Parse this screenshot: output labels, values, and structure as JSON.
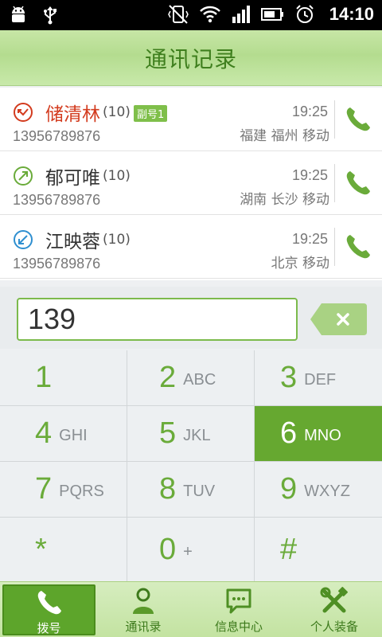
{
  "status_bar": {
    "time": "14:10"
  },
  "header": {
    "title": "通讯记录"
  },
  "call_log": [
    {
      "name": "储清林",
      "count": "(10)",
      "badge": "副号1",
      "number": "13956789876",
      "time": "19:25",
      "location": "福建 福州 移动",
      "type": "missed",
      "color": "#d33b1e"
    },
    {
      "name": "郁可唯",
      "count": "(10)",
      "badge": "",
      "number": "13956789876",
      "time": "19:25",
      "location": "湖南 长沙 移动",
      "type": "outgoing",
      "color": "#6aab3a"
    },
    {
      "name": "江映蓉",
      "count": "(10)",
      "badge": "",
      "number": "13956789876",
      "time": "19:25",
      "location": "北京 移动",
      "type": "incoming",
      "color": "#2f8fd0"
    }
  ],
  "dial_input": {
    "value": "139"
  },
  "keypad": [
    {
      "digit": "1",
      "letters": ""
    },
    {
      "digit": "2",
      "letters": "ABC"
    },
    {
      "digit": "3",
      "letters": "DEF"
    },
    {
      "digit": "4",
      "letters": "GHI"
    },
    {
      "digit": "5",
      "letters": "JKL"
    },
    {
      "digit": "6",
      "letters": "MNO",
      "active": true
    },
    {
      "digit": "7",
      "letters": "PQRS"
    },
    {
      "digit": "8",
      "letters": "TUV"
    },
    {
      "digit": "9",
      "letters": "WXYZ"
    },
    {
      "digit": "*",
      "letters": ""
    },
    {
      "digit": "0",
      "letters": "+"
    },
    {
      "digit": "#",
      "letters": ""
    }
  ],
  "bottom_nav": [
    {
      "label": "拨号",
      "icon": "phone-icon",
      "active": true
    },
    {
      "label": "通讯录",
      "icon": "contacts-icon"
    },
    {
      "label": "信息中心",
      "icon": "message-icon"
    },
    {
      "label": "个人装备",
      "icon": "tools-icon"
    }
  ],
  "colors": {
    "accent": "#66a830",
    "title_text": "#3f7f1e",
    "missed": "#d33b1e",
    "outgoing": "#6aab3a",
    "incoming": "#2f8fd0"
  }
}
